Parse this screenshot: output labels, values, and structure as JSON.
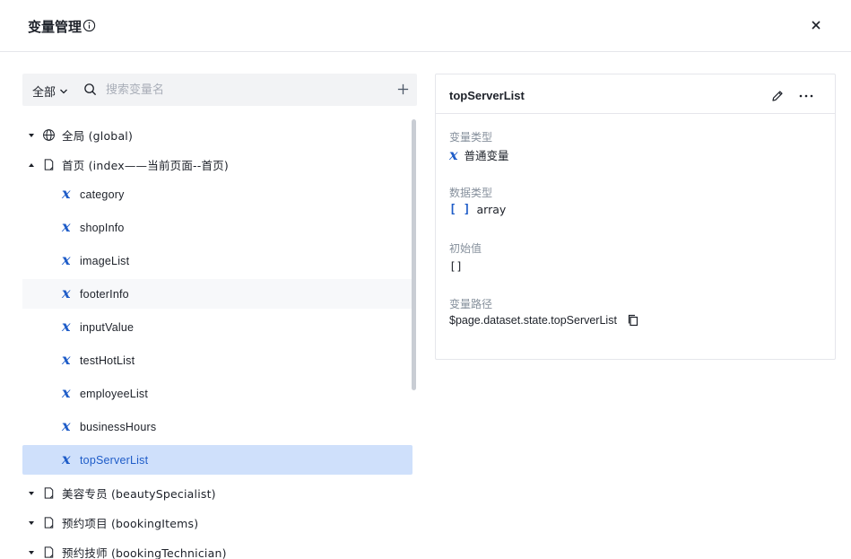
{
  "header": {
    "title": "变量管理"
  },
  "search": {
    "scope_label": "全部",
    "placeholder": "搜索变量名"
  },
  "tree": {
    "groups": [
      {
        "label": "全局 (global)"
      },
      {
        "label": "首页 (index——当前页面--首页)"
      },
      {
        "label": "美容专员 (beautySpecialist)"
      },
      {
        "label": "预约项目 (bookingItems)"
      },
      {
        "label": "预约技师 (bookingTechnician)"
      }
    ],
    "variables": [
      {
        "label": "category"
      },
      {
        "label": "shopInfo"
      },
      {
        "label": "imageList"
      },
      {
        "label": "footerInfo"
      },
      {
        "label": "inputValue"
      },
      {
        "label": "testHotList"
      },
      {
        "label": "employeeList"
      },
      {
        "label": "businessHours"
      },
      {
        "label": "topServerList"
      }
    ]
  },
  "detail": {
    "title": "topServerList",
    "var_type_label": "变量类型",
    "var_type_value": "普通变量",
    "data_type_label": "数据类型",
    "data_type_value": "array",
    "initial_label": "初始值",
    "initial_value": "[]",
    "path_label": "变量路径",
    "path_value": "$page.dataset.state.topServerList"
  },
  "colors": {
    "accent": "#1e5cc8",
    "selected_bg": "#cfe0fb",
    "muted_text": "#86909c",
    "border": "#e5e6eb",
    "search_bg": "#f2f3f5"
  }
}
